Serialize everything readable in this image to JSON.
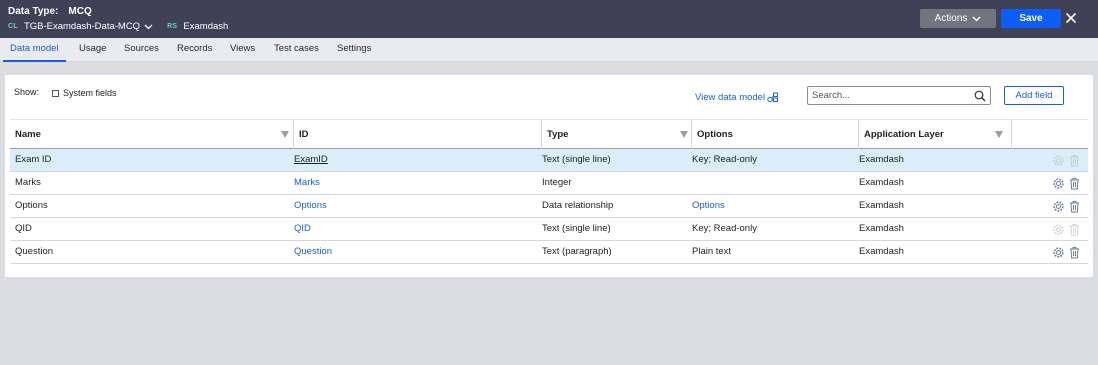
{
  "header": {
    "data_type_label": "Data Type:",
    "data_type_value": "MCQ",
    "class_tag": "CL",
    "class_name": "TGB-Examdash-Data-MCQ",
    "ruleset_tag": "RS",
    "ruleset_name": "Examdash",
    "actions_label": "Actions",
    "save_label": "Save"
  },
  "tabs": [
    {
      "label": "Data model",
      "active": true
    },
    {
      "label": "Usage"
    },
    {
      "label": "Sources"
    },
    {
      "label": "Records"
    },
    {
      "label": "Views"
    },
    {
      "label": "Test cases"
    },
    {
      "label": "Settings"
    }
  ],
  "toolbar": {
    "show_label": "Show:",
    "system_fields_label": "System fields",
    "view_data_model_label": "View data model",
    "search_placeholder": "Search...",
    "add_field_label": "Add field"
  },
  "table": {
    "columns": [
      "Name",
      "ID",
      "Type",
      "Options",
      "Application Layer"
    ],
    "rows": [
      {
        "name": "Exam ID",
        "id": "ExamID",
        "type": "Text (single line)",
        "options": "Key; Read-only",
        "layer": "Examdash",
        "selected": true,
        "actions_enabled": false
      },
      {
        "name": "Marks",
        "id": "Marks",
        "type": "Integer",
        "options": "",
        "layer": "Examdash",
        "actions_enabled": true
      },
      {
        "name": "Options",
        "id": "Options",
        "type": "Data relationship",
        "options": "Options",
        "options_link": true,
        "layer": "Examdash",
        "actions_enabled": true
      },
      {
        "name": "QID",
        "id": "QID",
        "type": "Text (single line)",
        "options": "Key; Read-only",
        "layer": "Examdash",
        "actions_enabled": false
      },
      {
        "name": "Question",
        "id": "Question",
        "type": "Text (paragraph)",
        "options": "Plain text",
        "layer": "Examdash",
        "actions_enabled": true
      }
    ]
  },
  "colors": {
    "header_bg": "#3f4257",
    "accent": "#1a5fd6",
    "save_bg": "#0d5df8",
    "selected_row": "#d9eef9"
  }
}
